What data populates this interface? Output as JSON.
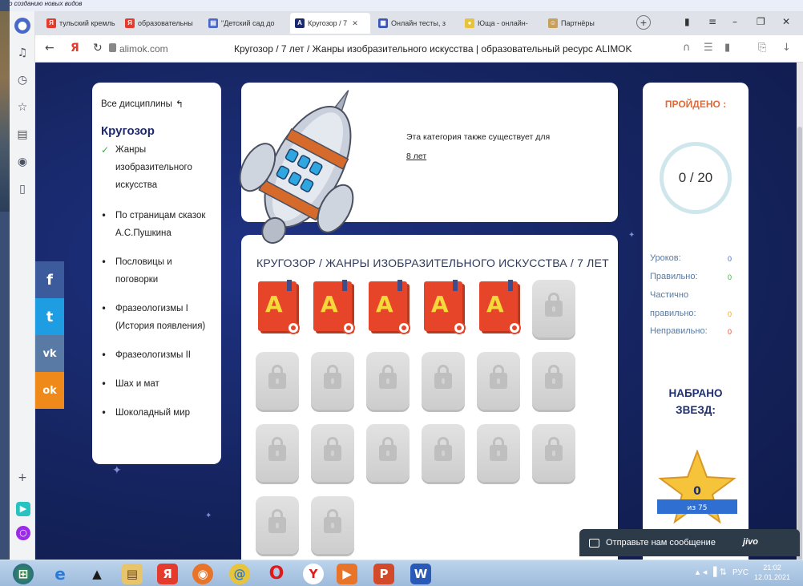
{
  "desktop": {
    "corner_text": "ило созданию новых видов"
  },
  "rail": {
    "icons": [
      "bell-icon",
      "history-icon",
      "favorites-icon",
      "notes-icon",
      "play-icon",
      "sidebar-icon",
      "add-icon"
    ]
  },
  "tabs": [
    {
      "label": "тульский кремль",
      "favicon": "Я",
      "favicon_color": "#e43b2c"
    },
    {
      "label": "образовательны",
      "favicon": "Я",
      "favicon_color": "#e43b2c"
    },
    {
      "label": "\"Детский сад до",
      "favicon": "▤",
      "favicon_color": "#4a68c8"
    },
    {
      "label": "Кругозор / 7",
      "favicon": "A",
      "favicon_color": "#1b2a6e",
      "active": true
    },
    {
      "label": "Онлайн тесты, з",
      "favicon": "▦",
      "favicon_color": "#3a55b8"
    },
    {
      "label": "Юща - онлайн-",
      "favicon": "●",
      "favicon_color": "#e8c23a"
    },
    {
      "label": "Партнёры",
      "favicon": "☺",
      "favicon_color": "#c8a05a"
    }
  ],
  "addressbar": {
    "domain": "alimok.com",
    "title": "Кругозор / 7 лет / Жанры изобразительного искусства | образовательный ресурс ALIMOK"
  },
  "social": [
    {
      "label": "f",
      "color": "#3b5b9c"
    },
    {
      "label": "t",
      "color": "#1e9de3"
    },
    {
      "label": "vk",
      "color": "#5a7aa6"
    },
    {
      "label": "ok",
      "color": "#ef8a1a"
    }
  ],
  "sidebar": {
    "all_label": "Все дисциплины",
    "title": "Кругозор",
    "items": [
      {
        "label": "Жанры изобразительного искусства",
        "current": true
      },
      {
        "label": "По страницам сказок А.С.Пушкина"
      },
      {
        "label": "Пословицы и поговорки"
      },
      {
        "label": "Фразеологизмы I (История появления)"
      },
      {
        "label": "Фразеологизмы II"
      },
      {
        "label": "Шах и мат"
      },
      {
        "label": "Шоколадный мир"
      }
    ]
  },
  "info": {
    "text": "Эта категория также существует для",
    "link": "8 лет"
  },
  "main": {
    "heading": "КРУГОЗОР / ЖАНРЫ ИЗОБРАЗИТЕЛЬНОГО ИСКУССТВА / 7 ЛЕТ",
    "open_tile_letter": "A",
    "tiles_open": 5,
    "tiles_total": 20
  },
  "stats": {
    "passed_title": "ПРОЙДЕНО :",
    "progress_text": "0 / 20",
    "rows": [
      {
        "label": "Уроков:",
        "value": "0",
        "color": "#3a6bd6"
      },
      {
        "label": "Правильно:",
        "value": "0",
        "color": "#3fae3f"
      },
      {
        "label": "Частично",
        "value": ""
      },
      {
        "label": "правильно:",
        "value": "0",
        "color": "#e8a820"
      },
      {
        "label": "Неправильно:",
        "value": "0",
        "color": "#e04a3a"
      }
    ],
    "stars_title_1": "НАБРАНО",
    "stars_title_2": "ЗВЕЗД:",
    "stars_value": "0",
    "stars_of": "из 75"
  },
  "chat": {
    "label": "Отправьте нам сообщение",
    "brand": "jivo"
  },
  "taskbar": {
    "lang": "РУС",
    "time": "21:02",
    "date": "12.01.2021"
  }
}
